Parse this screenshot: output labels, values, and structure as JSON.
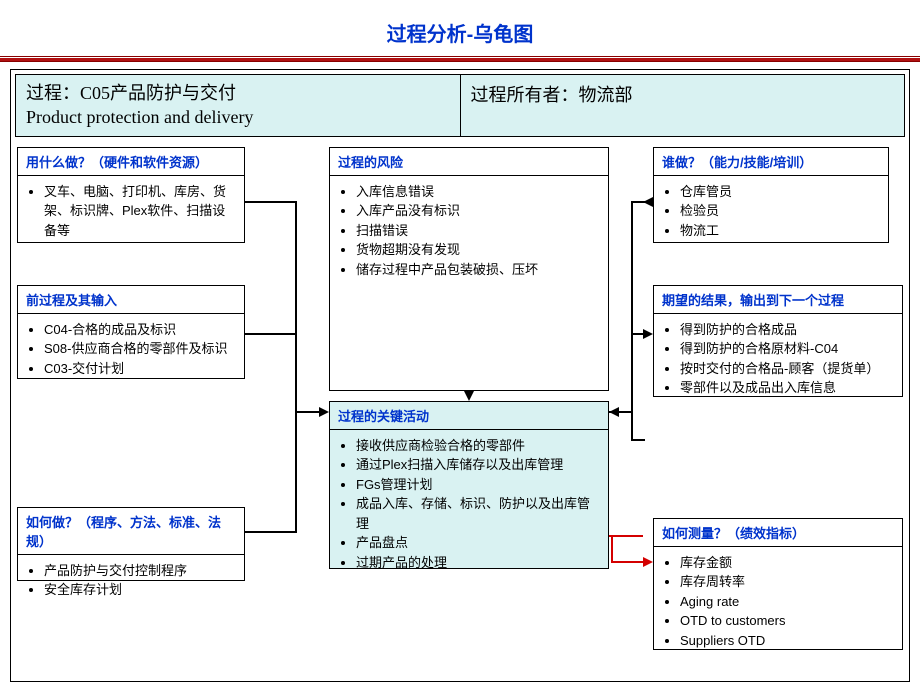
{
  "title": "过程分析-乌龟图",
  "header": {
    "process_label": "过程：C05产品防护与交付",
    "process_en": "Product protection and delivery",
    "owner_label": "过程所有者：物流部"
  },
  "boxes": {
    "resources": {
      "title": "用什么做？（硬件和软件资源）",
      "items": [
        "叉车、电脑、打印机、库房、货架、标识牌、Plex软件、扫描设备等"
      ]
    },
    "risks": {
      "title": "过程的风险",
      "items": [
        "入库信息错误",
        "入库产品没有标识",
        "扫描错误",
        "货物超期没有发现",
        "储存过程中产品包装破损、压坏"
      ]
    },
    "who": {
      "title": "谁做？（能力/技能/培训）",
      "items": [
        "仓库管员",
        "检验员",
        "物流工"
      ]
    },
    "input": {
      "title": "前过程及其输入",
      "items": [
        "C04-合格的成品及标识",
        "S08-供应商合格的零部件及标识",
        "C03-交付计划"
      ]
    },
    "output": {
      "title": "期望的结果，输出到下一个过程",
      "items": [
        "得到防护的合格成品",
        "得到防护的合格原材料-C04",
        "按时交付的合格品-顾客（提货单）",
        "零部件以及成品出入库信息"
      ]
    },
    "key": {
      "title": "过程的关键活动",
      "items": [
        "接收供应商检验合格的零部件",
        "通过Plex扫描入库储存以及出库管理",
        "FGs管理计划",
        "成品入库、存储、标识、防护以及出库管理",
        "产品盘点",
        "过期产品的处理"
      ]
    },
    "how": {
      "title": "如何做？（程序、方法、标准、法规）",
      "items": [
        "产品防护与交付控制程序",
        "安全库存计划"
      ]
    },
    "measure": {
      "title": "如何测量？（绩效指标）",
      "items": [
        "库存金额",
        "库存周转率",
        "Aging rate",
        "OTD to customers",
        "Suppliers OTD"
      ]
    }
  }
}
